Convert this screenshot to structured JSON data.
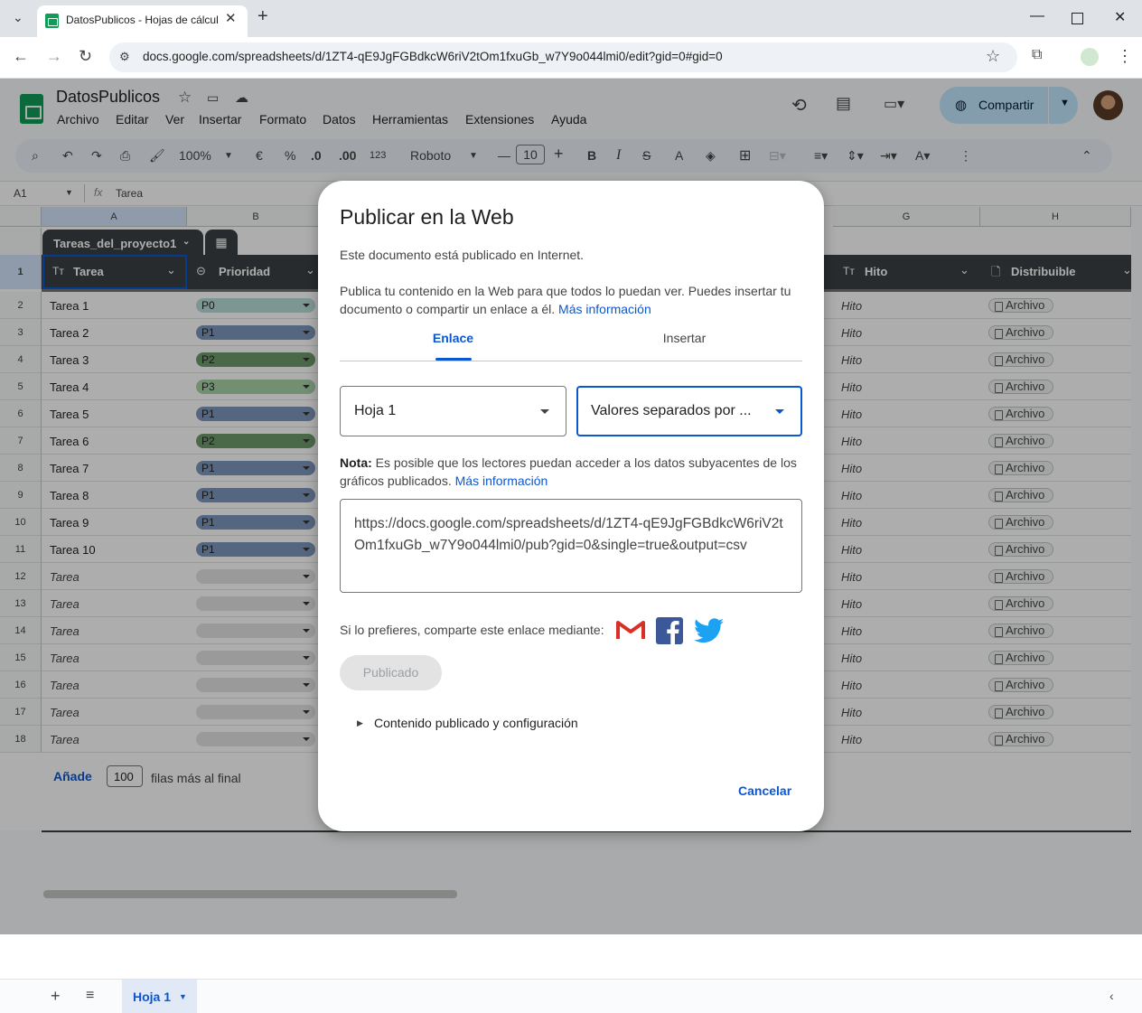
{
  "browser": {
    "tab_title": "DatosPublicos - Hojas de cálcul",
    "url": "docs.google.com/spreadsheets/d/1ZT4-qE9JgFGBdkcW6riV2tOm1fxuGb_w7Y9o044lmi0/edit?gid=0#gid=0"
  },
  "doc": {
    "name": "DatosPublicos",
    "menus": [
      "Archivo",
      "Editar",
      "Ver",
      "Insertar",
      "Formato",
      "Datos",
      "Herramientas",
      "Extensiones",
      "Ayuda"
    ],
    "share_label": "Compartir"
  },
  "toolbar": {
    "zoom": "100%",
    "currency": "€",
    "percent": "%",
    "dec_dec": ".0",
    "dec_inc": ".00",
    "number_fmt": "123",
    "font": "Roboto",
    "font_size": "10"
  },
  "formula_bar": {
    "cell_ref": "A1",
    "content": "Tarea"
  },
  "grid": {
    "columns": [
      "A",
      "B",
      "G",
      "H"
    ],
    "table_name": "Tareas_del_proyecto1",
    "headers": {
      "tarea": "Tarea",
      "prioridad": "Prioridad",
      "hito": "Hito",
      "distribuible": "Distribuible"
    },
    "rows": [
      {
        "n": "2",
        "tarea": "Tarea 1",
        "prio": "P0",
        "hito": "Hito",
        "dist": "Archivo"
      },
      {
        "n": "3",
        "tarea": "Tarea 2",
        "prio": "P1",
        "hito": "Hito",
        "dist": "Archivo"
      },
      {
        "n": "4",
        "tarea": "Tarea 3",
        "prio": "P2",
        "hito": "Hito",
        "dist": "Archivo"
      },
      {
        "n": "5",
        "tarea": "Tarea 4",
        "prio": "P3",
        "hito": "Hito",
        "dist": "Archivo"
      },
      {
        "n": "6",
        "tarea": "Tarea 5",
        "prio": "P1",
        "hito": "Hito",
        "dist": "Archivo"
      },
      {
        "n": "7",
        "tarea": "Tarea 6",
        "prio": "P2",
        "hito": "Hito",
        "dist": "Archivo"
      },
      {
        "n": "8",
        "tarea": "Tarea 7",
        "prio": "P1",
        "hito": "Hito",
        "dist": "Archivo"
      },
      {
        "n": "9",
        "tarea": "Tarea 8",
        "prio": "P1",
        "hito": "Hito",
        "dist": "Archivo"
      },
      {
        "n": "10",
        "tarea": "Tarea 9",
        "prio": "P1",
        "hito": "Hito",
        "dist": "Archivo"
      },
      {
        "n": "11",
        "tarea": "Tarea 10",
        "prio": "P1",
        "hito": "Hito",
        "dist": "Archivo"
      },
      {
        "n": "12",
        "tarea": "Tarea",
        "prio": "",
        "hito": "Hito",
        "dist": "Archivo"
      },
      {
        "n": "13",
        "tarea": "Tarea",
        "prio": "",
        "hito": "Hito",
        "dist": "Archivo"
      },
      {
        "n": "14",
        "tarea": "Tarea",
        "prio": "",
        "hito": "Hito",
        "dist": "Archivo"
      },
      {
        "n": "15",
        "tarea": "Tarea",
        "prio": "",
        "hito": "Hito",
        "dist": "Archivo"
      },
      {
        "n": "16",
        "tarea": "Tarea",
        "prio": "",
        "hito": "Hito",
        "dist": "Archivo"
      },
      {
        "n": "17",
        "tarea": "Tarea",
        "prio": "",
        "hito": "Hito",
        "dist": "Archivo"
      },
      {
        "n": "18",
        "tarea": "Tarea",
        "prio": "",
        "hito": "Hito",
        "dist": "Archivo"
      }
    ],
    "prio_colors": {
      "P0": "#b7dedb",
      "P1": "#7e97bd",
      "P2": "#6d9b6b",
      "P3": "#a9d3a7",
      "": "#e3e3e3"
    },
    "add_label": "Añade",
    "add_count": "100",
    "add_suffix": "filas más al final"
  },
  "sheet_tab": "Hoja 1",
  "dialog": {
    "title": "Publicar en la Web",
    "status": "Este documento está publicado en Internet.",
    "desc": "Publica tu contenido en la Web para que todos lo puedan ver. Puedes insertar tu documento o compartir un enlace a él.",
    "more_info": "Más información",
    "tab_link": "Enlace",
    "tab_embed": "Insertar",
    "sheet_select": "Hoja 1",
    "format_select": "Valores separados por ...",
    "note_label": "Nota:",
    "note_text": "Es posible que los lectores puedan acceder a los datos subyacentes de los gráficos publicados.",
    "note_link": "Más información",
    "publish_url": "https://docs.google.com/spreadsheets/d/1ZT4-qE9JgFGBdkcW6riV2tOm1fxuGb_w7Y9o044lmi0/pub?gid=0&single=true&output=csv",
    "share_via": "Si lo prefieres, comparte este enlace mediante:",
    "published_button": "Publicado",
    "expand_label": "Contenido publicado y configuración",
    "cancel": "Cancelar"
  }
}
